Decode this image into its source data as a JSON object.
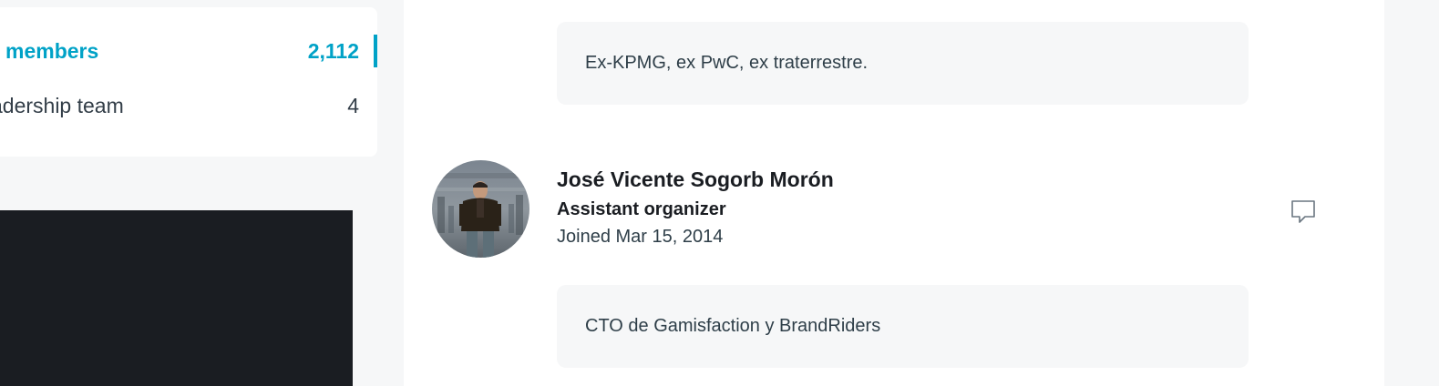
{
  "sidebar": {
    "items": [
      {
        "label": "members",
        "count": "2,112"
      },
      {
        "label": "adership team",
        "count": "4"
      }
    ]
  },
  "members": [
    {
      "bio": "Ex-KPMG, ex PwC, ex traterrestre."
    },
    {
      "name": "José Vicente Sogorb Morón",
      "role": "Assistant organizer",
      "joined": "Joined Mar 15, 2014",
      "bio": "CTO de Gamisfaction y BrandRiders",
      "message_icon": "chat-bubble-icon"
    }
  ],
  "colors": {
    "accent": "#00a2c7",
    "dark_block": "#1a1d22",
    "page_bg": "#f6f7f8"
  }
}
